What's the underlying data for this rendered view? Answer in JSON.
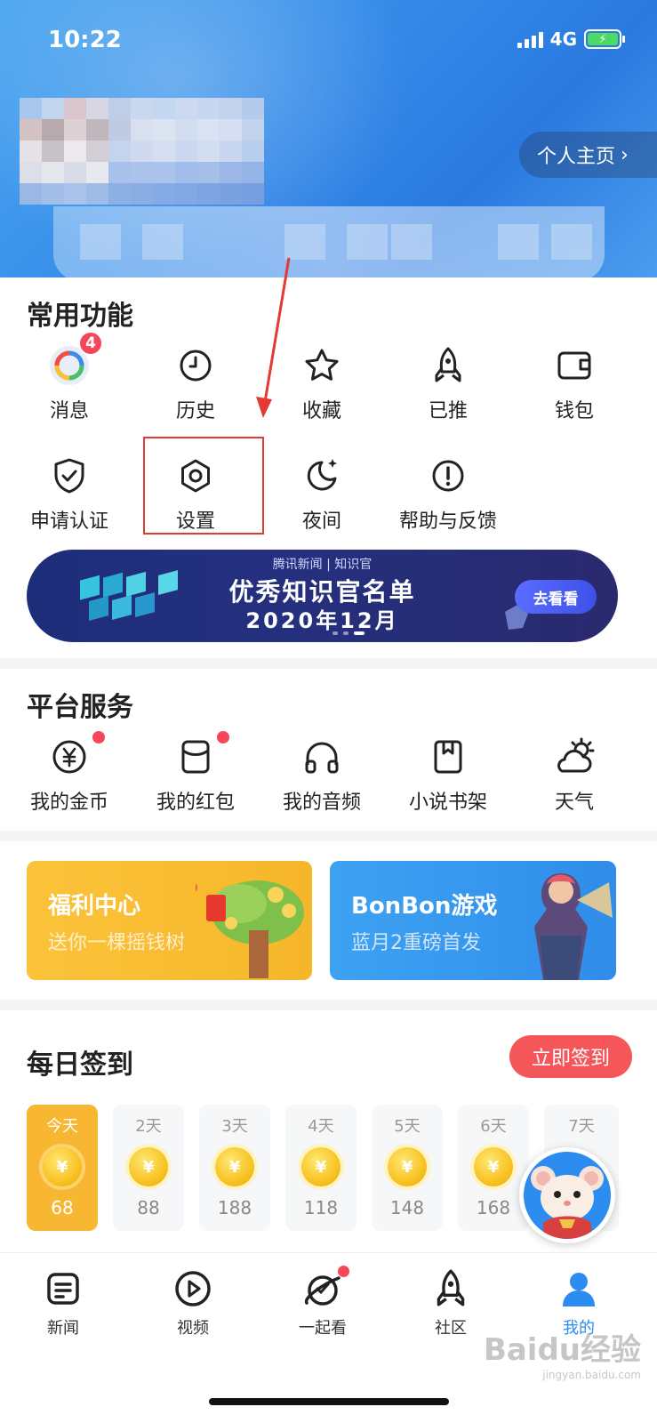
{
  "status": {
    "time": "10:22",
    "network": "4G"
  },
  "header": {
    "profile_button": "个人主页"
  },
  "common": {
    "title": "常用功能",
    "items": [
      {
        "label": "消息",
        "icon": "news-logo-icon",
        "badge": "4"
      },
      {
        "label": "历史",
        "icon": "clock-icon"
      },
      {
        "label": "收藏",
        "icon": "star-icon"
      },
      {
        "label": "已推",
        "icon": "rocket-icon"
      },
      {
        "label": "钱包",
        "icon": "wallet-icon"
      },
      {
        "label": "申请认证",
        "icon": "shield-check-icon"
      },
      {
        "label": "设置",
        "icon": "settings-hexagon-icon"
      },
      {
        "label": "夜间",
        "icon": "moon-icon"
      },
      {
        "label": "帮助与反馈",
        "icon": "help-exclamation-icon"
      }
    ]
  },
  "banner": {
    "brand": "腾讯新闻 | 知识官",
    "title": "优秀知识官名单",
    "subtitle": "2020年12月",
    "button": "去看看"
  },
  "platform": {
    "title": "平台服务",
    "items": [
      {
        "label": "我的金币",
        "icon": "yen-coin-icon",
        "dot": true
      },
      {
        "label": "我的红包",
        "icon": "red-packet-icon",
        "dot": true
      },
      {
        "label": "我的音频",
        "icon": "headphones-icon"
      },
      {
        "label": "小说书架",
        "icon": "bookmark-icon"
      },
      {
        "label": "天气",
        "icon": "weather-icon"
      }
    ]
  },
  "promos": [
    {
      "title": "福利中心",
      "subtitle": "送你一棵摇钱树",
      "color": "#f8be3a"
    },
    {
      "title": "BonBon游戏",
      "subtitle": "蓝月2重磅首发",
      "color": "#3a9af0"
    }
  ],
  "checkin": {
    "title": "每日签到",
    "button": "立即签到",
    "days": [
      {
        "day": "今天",
        "coins": "68"
      },
      {
        "day": "2天",
        "coins": "88"
      },
      {
        "day": "3天",
        "coins": "188"
      },
      {
        "day": "4天",
        "coins": "118"
      },
      {
        "day": "5天",
        "coins": "148"
      },
      {
        "day": "6天",
        "coins": "168"
      },
      {
        "day": "7天",
        "coins": ""
      }
    ],
    "coin_symbol": "¥"
  },
  "tabs": [
    {
      "label": "新闻",
      "icon": "news-doc-icon"
    },
    {
      "label": "视频",
      "icon": "play-circle-icon"
    },
    {
      "label": "一起看",
      "icon": "planet-icon"
    },
    {
      "label": "社区",
      "icon": "rocket-icon"
    },
    {
      "label": "我的",
      "icon": "user-icon"
    }
  ],
  "watermark": {
    "main": "Baidu经验",
    "sub": "jingyan.baidu.com"
  },
  "colors": {
    "accent": "#2b8cf2",
    "red": "#f5475a",
    "highlight": "#e53935"
  }
}
